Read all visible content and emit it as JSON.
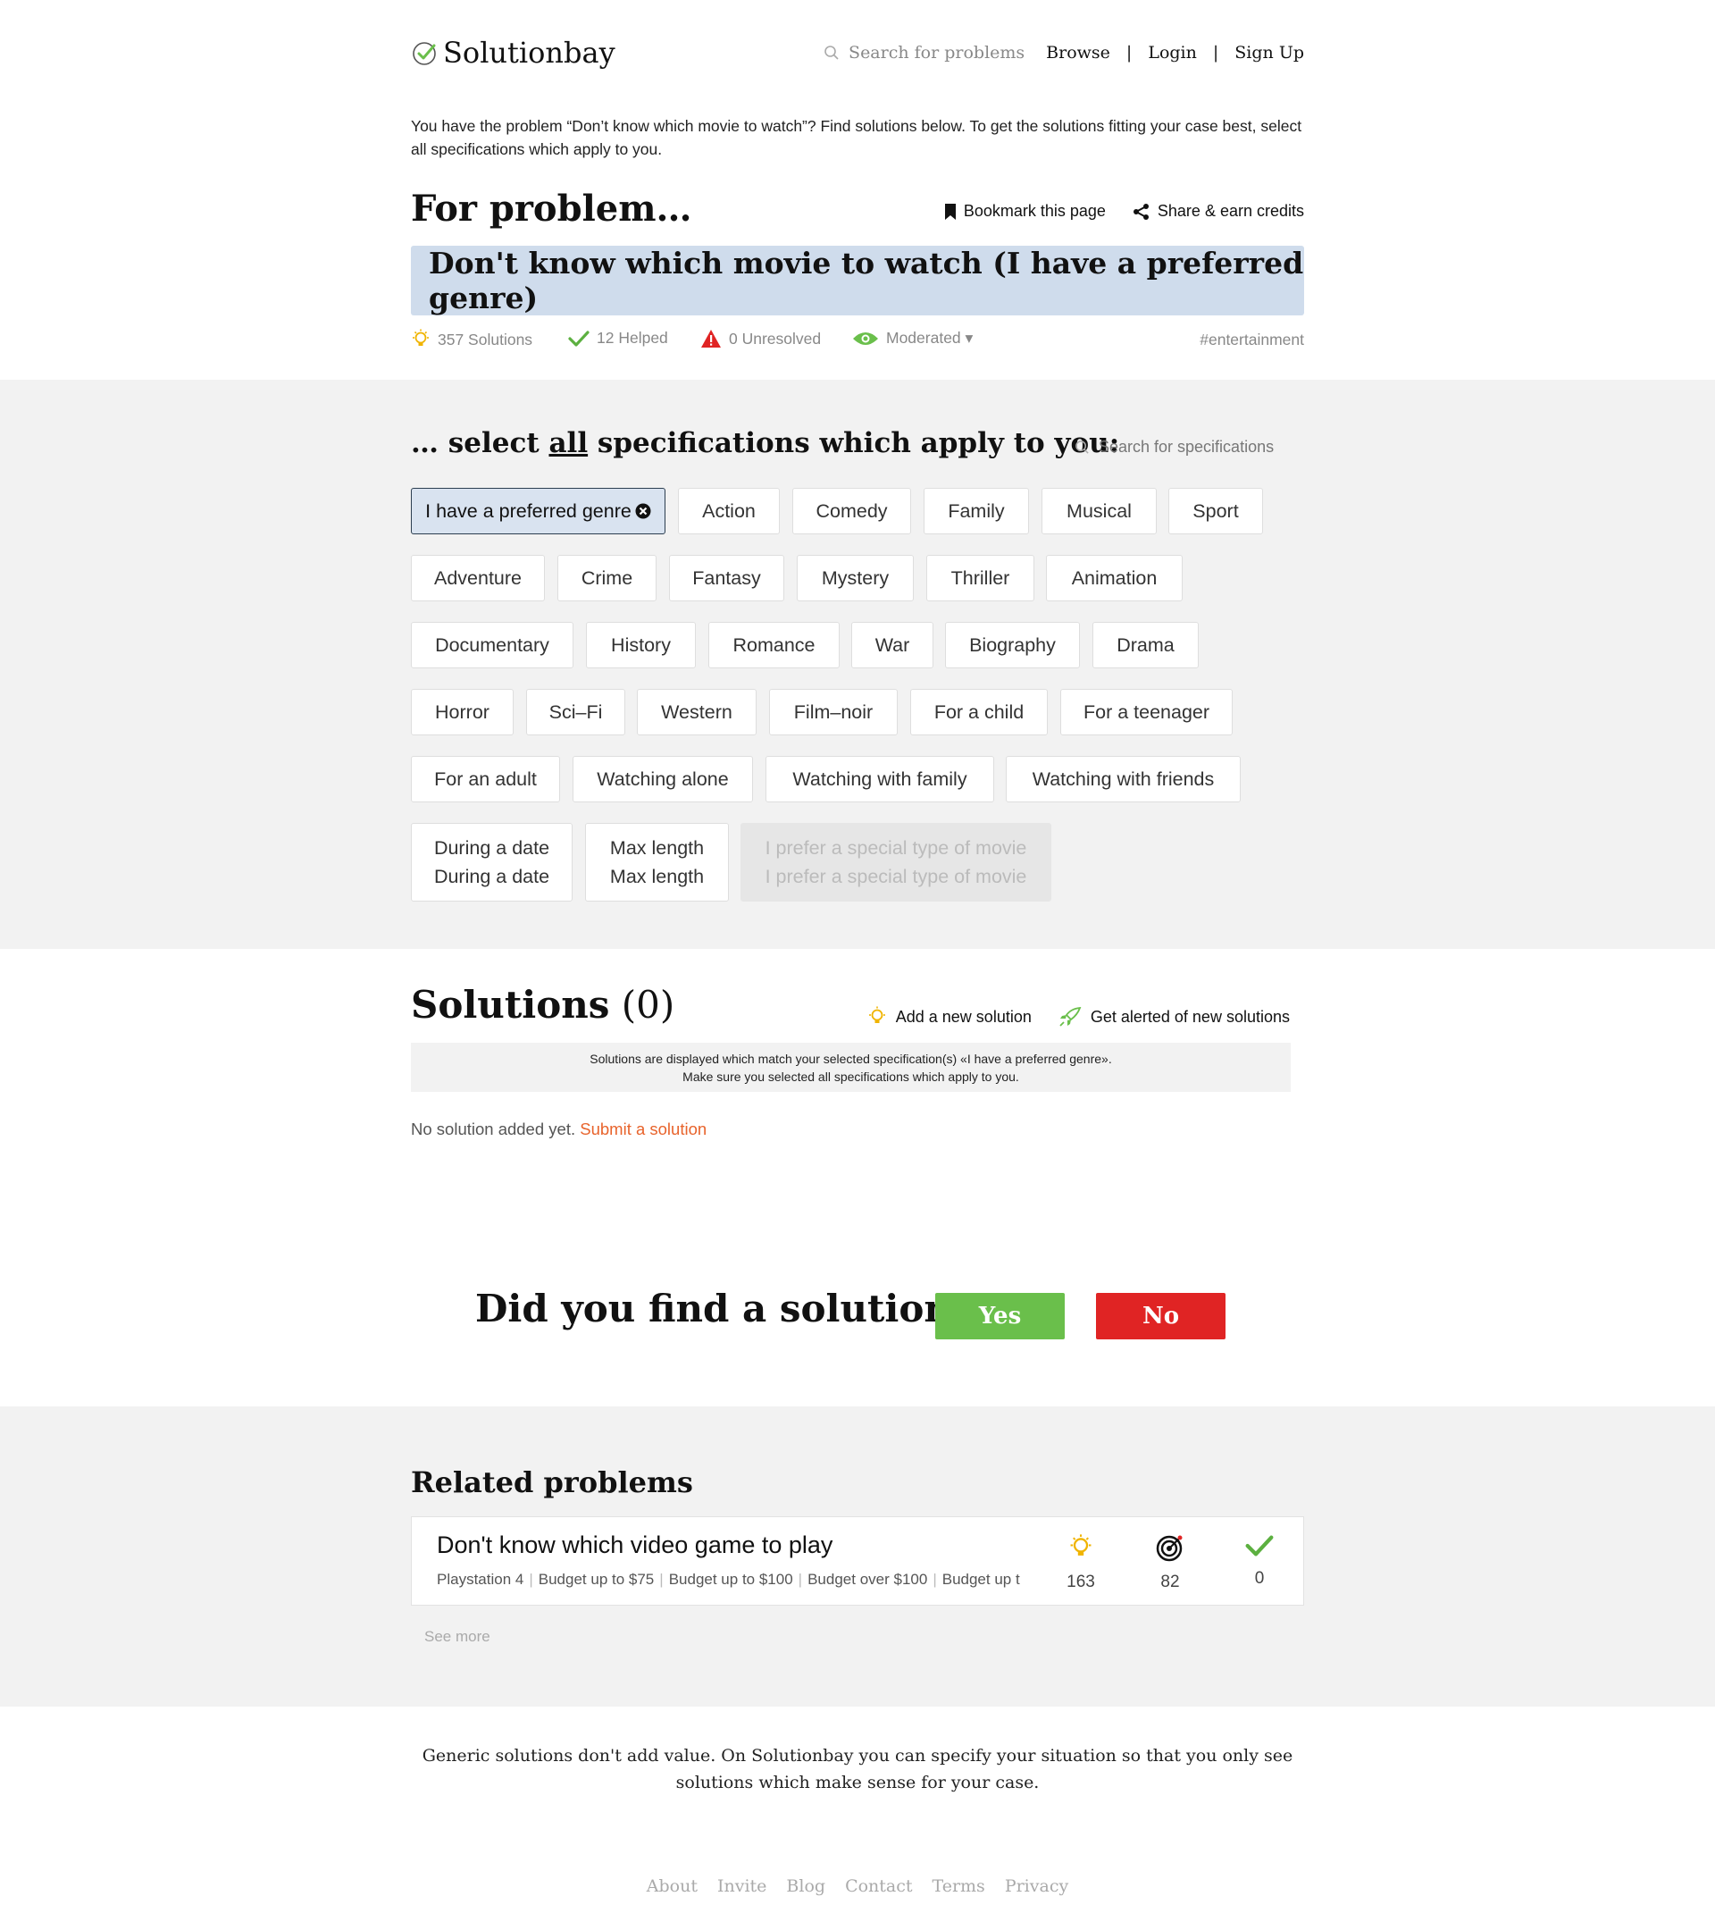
{
  "header": {
    "logo_text": "Solutionbay",
    "search_placeholder": "Search for problems",
    "nav": {
      "browse": "Browse",
      "sep1": "|",
      "login": "Login",
      "sep2": "|",
      "signup": "Sign Up"
    }
  },
  "intro": "You have the problem “Don’t know which movie to watch”? Find solutions below. To get the solutions fitting your case best, select all specifications which apply to you.",
  "problem": {
    "heading": "For problem…",
    "bookmark": "Bookmark this page",
    "share": "Share & earn credits",
    "title": "Don't know which movie to watch (I have a preferred genre)",
    "stats": {
      "solutions": "357 Solutions",
      "helped": "12 Helped",
      "unresolved": "0 Unresolved",
      "moderated": "Moderated ▾"
    },
    "tag": "#entertainment"
  },
  "specs": {
    "title_pre": "… select ",
    "title_u": "all",
    "title_post": " specifications which apply to you:",
    "search_placeholder": "Search for specifications",
    "selected": "I have a preferred genre",
    "chips": {
      "action": "Action",
      "comedy": "Comedy",
      "family": "Family",
      "musical": "Musical",
      "sport": "Sport",
      "adventure": "Adventure",
      "crime": "Crime",
      "fantasy": "Fantasy",
      "mystery": "Mystery",
      "thriller": "Thriller",
      "animation": "Animation",
      "documentary": "Documentary",
      "history": "History",
      "romance": "Romance",
      "war": "War",
      "biography": "Biography",
      "drama": "Drama",
      "horror": "Horror",
      "scifi": "Sci–Fi",
      "western": "Western",
      "filmnoir": "Film–noir",
      "child": "For a child",
      "teenager": "For a teenager",
      "adult": "For an adult",
      "alone": "Watching alone",
      "with_family": "Watching with family",
      "with_friends": "Watching with friends",
      "date": "During a date",
      "maxlen": "Max length",
      "special": "I prefer a special type of movie"
    }
  },
  "solutions": {
    "title": "Solutions",
    "count": "(0)",
    "add": "Add a new solution",
    "alert": "Get alerted of new solutions",
    "note_line1": "Solutions are displayed which match your selected specification(s) «I have a preferred genre».",
    "note_line2": "Make sure you selected all specifications which apply to you.",
    "none_text": "No solution added yet.",
    "submit_link": "Submit a solution"
  },
  "feedback": {
    "question": "Did you find a solution?",
    "yes": "Yes",
    "no": "No"
  },
  "related": {
    "title": "Related problems",
    "card": {
      "title": "Don't know which video game to play",
      "tags": [
        "Playstation 4",
        "Budget up to $75",
        "Budget up to $100",
        "Budget over $100",
        "Budget up t"
      ],
      "solutions": "163",
      "targets": "82",
      "helped": "0"
    },
    "see_more": "See more"
  },
  "footer": {
    "text": "Generic solutions don't add value. On Solutionbay you can specify your situation so that you only see solutions which make sense for your case.",
    "links": {
      "about": "About",
      "invite": "Invite",
      "blog": "Blog",
      "contact": "Contact",
      "terms": "Terms",
      "privacy": "Privacy"
    }
  },
  "colors": {
    "accent_green": "#6abf4b",
    "danger_red": "#e02424",
    "link_orange": "#e8632b",
    "problem_bg": "#cfdcec",
    "band_bg": "#f2f2f2"
  }
}
